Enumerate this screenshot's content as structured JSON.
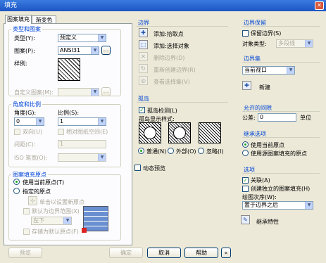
{
  "window": {
    "title": "填充"
  },
  "tabs": [
    "图案填充",
    "渐变色"
  ],
  "type_pattern": {
    "legend": "类型和图案",
    "type_label": "类型(Y):",
    "type_value": "预定义",
    "pattern_label": "图案(P):",
    "pattern_value": "ANSI31",
    "browse_label": "...",
    "sample_label": "样例:",
    "custom_label": "自定义图案(M):",
    "custom_browse": "..."
  },
  "angle_scale": {
    "legend": "角度和比例",
    "angle_label": "角度(G):",
    "angle_value": "0",
    "scale_label": "比例(S):",
    "scale_value": "1",
    "double_label": "双向(U)",
    "relative_label": "相对图纸空间(E)",
    "spacing_label": "间距(C):",
    "spacing_value": "1",
    "iso_label": "ISO 笔宽(O):"
  },
  "origin": {
    "legend": "图案填充原点",
    "use_current": "使用当前原点(T)",
    "specified": "指定的原点",
    "click_set": "单击以设置新原点",
    "default_boundary": "默认为边界范围(X)",
    "position_value": "左下",
    "store_default": "存储为默认原点(F)"
  },
  "boundary": {
    "legend": "边界",
    "add_pick": "添加:拾取点",
    "add_select": "添加:选择对象",
    "remove": "删除边界(D)",
    "recreate": "重新创建边界(R)",
    "view": "查看选择集(V)"
  },
  "islands": {
    "legend": "孤岛",
    "detect_label": "孤岛检测(L)",
    "style_label": "孤岛显示样式:",
    "normal": "普通(N)",
    "outer": "外部(O)",
    "ignore": "忽略(I)"
  },
  "retain": {
    "legend": "边界保留",
    "retain_label": "保留边界(S)",
    "object_type_label": "对象类型:",
    "object_type_value": "多段线"
  },
  "boundary_set": {
    "legend": "边界集",
    "value": "当前视口",
    "new_label": "新建"
  },
  "gap": {
    "legend": "允许的间隙",
    "tolerance_label": "公差:",
    "tolerance_value": "0",
    "unit": "单位"
  },
  "inherit_options": {
    "legend": "继承选项",
    "use_current": "使用当前原点",
    "use_source": "使用源图案填充的原点"
  },
  "options": {
    "legend": "选项",
    "associative": "关联(A)",
    "separate": "创建独立的图案填充(H)",
    "draw_order_label": "绘图次序(W):",
    "draw_order_value": "置于边界之后"
  },
  "inherit": {
    "label": "继承特性"
  },
  "dynamic_preview": "动态预览",
  "buttons": {
    "preview": "预览",
    "ok": "确定",
    "cancel": "取消",
    "help": "帮助",
    "collapse": "«"
  }
}
